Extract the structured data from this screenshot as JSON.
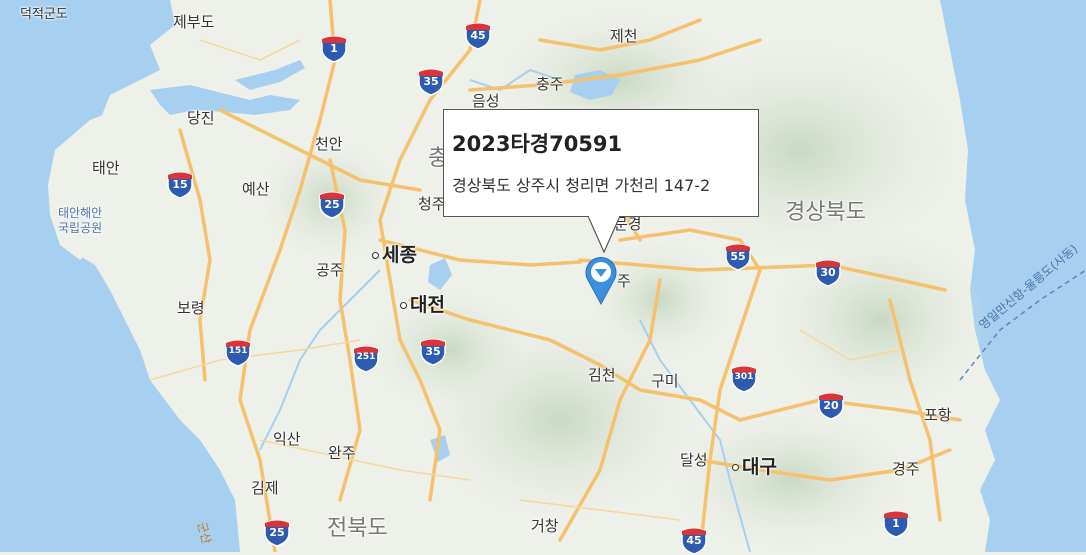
{
  "popup": {
    "case_number": "2023타경70591",
    "address": "경상북도 상주시 청리면 가천리 147-2"
  },
  "marker": {
    "icon": "map-pin-icon",
    "color": "#3b8fe0"
  },
  "provinces": {
    "north_gyeongsang": "경상북도",
    "north_jeolla": "전북도",
    "north_chungcheong_partial": "충"
  },
  "cities": {
    "deokjeok": "덕적군도",
    "jebudo": "제부도",
    "jecheon": "제천",
    "chungju": "충주",
    "eumseong": "음성",
    "dangjin": "당진",
    "taean": "태안",
    "cheonan": "천안",
    "yesan": "예산",
    "cheongju": "청주",
    "sejong": "세종",
    "gongju": "공주",
    "daejeon": "대전",
    "boryeong": "보령",
    "gimcheon": "김천",
    "gumi": "구미",
    "dalseong": "달성",
    "daegu": "대구",
    "pohang": "포항",
    "gyeongju": "경주",
    "iksan": "익산",
    "wanju": "완주",
    "gimje": "김제",
    "geochang": "거창",
    "mungyeong_partial": "문경",
    "sangju_partial": "주"
  },
  "water_labels": {
    "taean_park_line1": "태안해안",
    "taean_park_line2": "국립공원",
    "ferry_route": "영일만신항-울릉도(사동)",
    "west_route": "군산"
  },
  "highways": {
    "h1": "1",
    "h45": "45",
    "h35": "35",
    "h15": "15",
    "h25": "25",
    "h55": "55",
    "h30": "30",
    "h151": "151",
    "h251": "251",
    "h301": "301",
    "h20": "20"
  },
  "colors": {
    "water": "#a7cff0",
    "land": "#eef0ea",
    "road": "#f5c16c",
    "shield_blue": "#2d5bb0",
    "shield_red": "#d8343a"
  }
}
